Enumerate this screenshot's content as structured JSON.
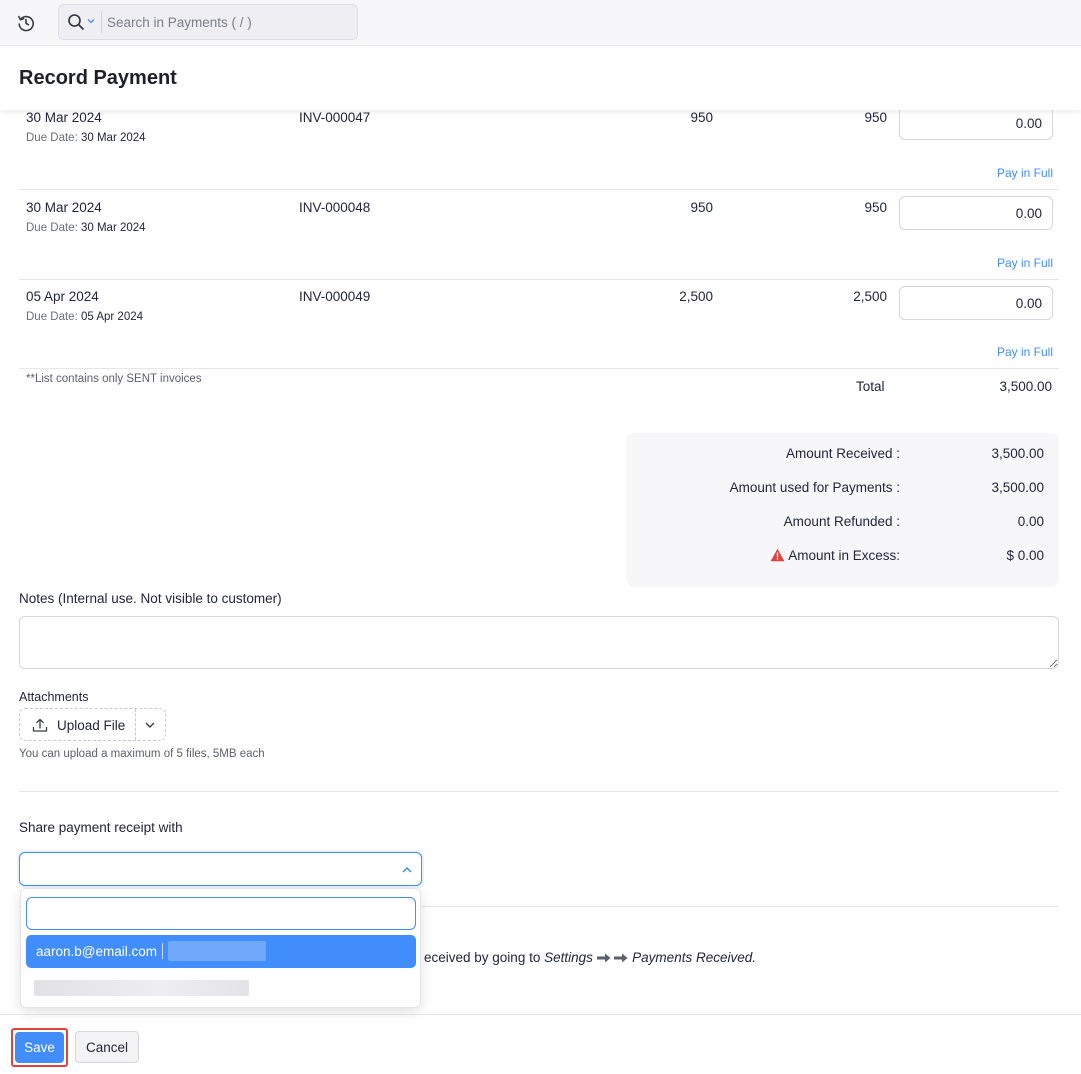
{
  "topbar": {
    "search_placeholder": "Search in Payments ( / )"
  },
  "page": {
    "title": "Record Payment"
  },
  "invoices": [
    {
      "date": "30 Mar 2024",
      "due_label": "Due Date",
      "due_date": "30 Mar 2024",
      "number": "INV-000047",
      "amount": "950",
      "amount_due": "950",
      "payment": "0.00",
      "pay_full": "Pay in Full"
    },
    {
      "date": "30 Mar 2024",
      "due_label": "Due Date",
      "due_date": "30 Mar 2024",
      "number": "INV-000048",
      "amount": "950",
      "amount_due": "950",
      "payment": "0.00",
      "pay_full": "Pay in Full"
    },
    {
      "date": "05 Apr 2024",
      "due_label": "Due Date",
      "due_date": "05 Apr 2024",
      "number": "INV-000049",
      "amount": "2,500",
      "amount_due": "2,500",
      "payment": "0.00",
      "pay_full": "Pay in Full"
    }
  ],
  "table_footer": {
    "note": "**List contains only SENT invoices",
    "total_label": "Total",
    "total_value": "3,500.00"
  },
  "summary": {
    "received_label": "Amount Received :",
    "received_value": "3,500.00",
    "used_label": "Amount used for Payments :",
    "used_value": "3,500.00",
    "refunded_label": "Amount Refunded :",
    "refunded_value": "0.00",
    "excess_label": "Amount in Excess:",
    "excess_value": "$  0.00"
  },
  "notes": {
    "label": "Notes (Internal use. Not visible to customer)",
    "value": ""
  },
  "attachments": {
    "label": "Attachments",
    "upload_label": "Upload File",
    "hint": "You can upload a maximum of 5 files, 5MB each"
  },
  "share": {
    "label": "Share payment receipt with",
    "selected": ""
  },
  "settings_note": {
    "prefix": "eceived by going to ",
    "settings": "Settings",
    "target": "Payments Received."
  },
  "dropdown": {
    "search_value": "",
    "option_email": "aaron.b@email.com"
  },
  "footer": {
    "save_label": "Save",
    "cancel_label": "Cancel"
  },
  "colors": {
    "accent": "#408dfb",
    "warning": "#e0433b"
  }
}
